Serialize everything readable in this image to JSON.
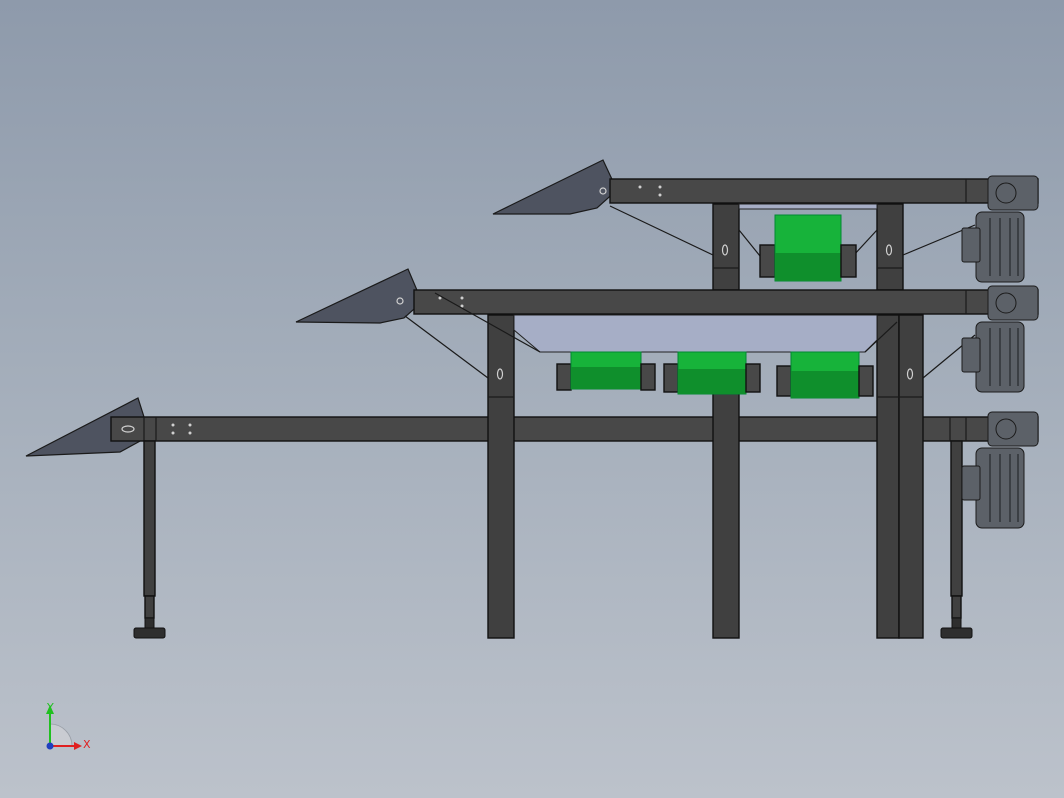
{
  "axis_triad": {
    "x_label": "X",
    "y_label": "Y",
    "x_color": "#e02020",
    "y_color": "#20c020",
    "origin_color": "#1f3fbf"
  },
  "colors": {
    "background_top": "#8e9aab",
    "background_bottom": "#bcc2cb",
    "frame_steel": "#484848",
    "roller_green": "#17b33a",
    "motor_grey": "#5c6168",
    "hood_lavender": "#a6aec6"
  },
  "model": {
    "description_view": "front",
    "conveyor_tiers": 3,
    "drive_motors": 3,
    "idler_rollers": 4
  }
}
